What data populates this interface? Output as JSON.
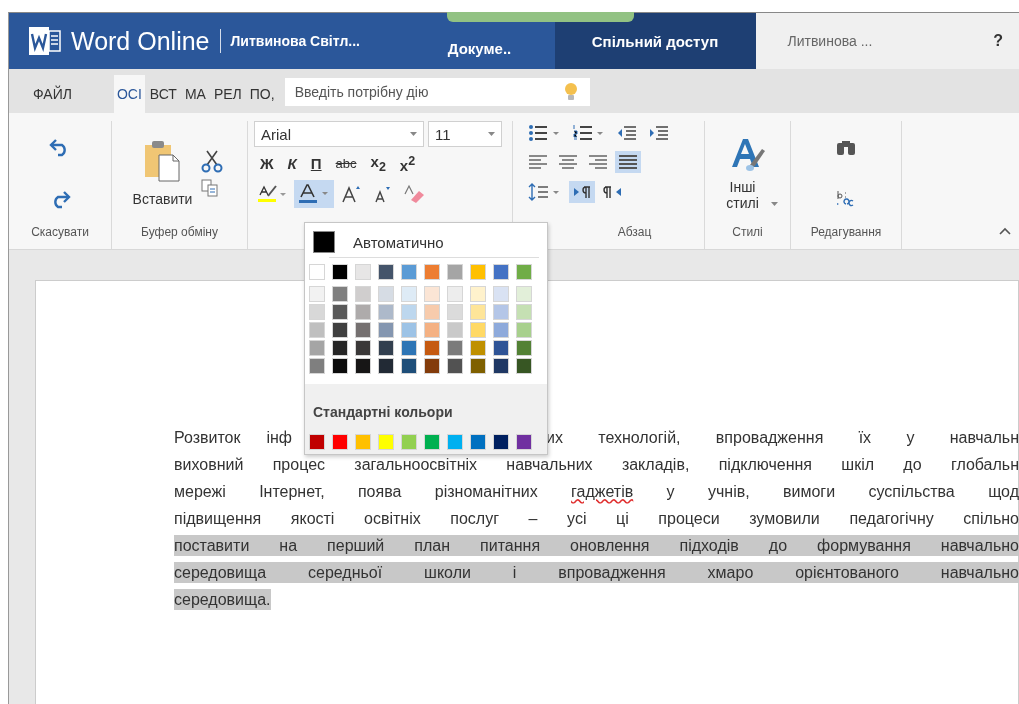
{
  "title_bar": {
    "app_name": "Word Online",
    "user": "Литвинова Світл...",
    "tabs": [
      {
        "label": "Докуме..",
        "selected": false
      },
      {
        "label": "Спільний доступ",
        "selected": true
      }
    ],
    "account": "Литвинова ...",
    "help": "?"
  },
  "ribbon_tabs": [
    {
      "label": "ФАЙЛ",
      "selected": false
    },
    {
      "label": "ОСІ",
      "selected": true
    },
    {
      "label": "ВСТ",
      "selected": false
    },
    {
      "label": "МА",
      "selected": false
    },
    {
      "label": "РЕЛ",
      "selected": false
    },
    {
      "label": "ПО,",
      "selected": false
    }
  ],
  "tell_me": {
    "placeholder": "Введіть потрібну дію"
  },
  "ribbon": {
    "undo_group": {
      "label": "Скасувати"
    },
    "clipboard_group": {
      "label": "Буфер обміну",
      "paste": "Вставити"
    },
    "font_group": {
      "font": "Arial",
      "size": "11",
      "format_buttons": [
        {
          "kind": "bold",
          "label": "Ж"
        },
        {
          "kind": "italic",
          "label": "К"
        },
        {
          "kind": "underline",
          "label": "П"
        },
        {
          "kind": "strike",
          "label": "abc"
        },
        {
          "kind": "subscript",
          "label": "x$_{2}$"
        },
        {
          "kind": "superscript",
          "label": "x$^{2}$"
        }
      ],
      "font_color_open": true
    },
    "paragraph_group": {
      "label": "Абзац",
      "alignment": [
        {
          "kind": "left",
          "selected": false
        },
        {
          "kind": "center",
          "selected": false
        },
        {
          "kind": "right",
          "selected": false
        },
        {
          "kind": "justify",
          "selected": true
        }
      ],
      "direction": [
        {
          "kind": "ltr",
          "selected": true
        },
        {
          "kind": "rtl",
          "selected": false
        }
      ]
    },
    "styles_group": {
      "label": "Стилі",
      "button": "Інші стилі"
    },
    "editing_group": {
      "label": "Редагування"
    }
  },
  "color_menu": {
    "automatic": "Автоматично",
    "theme_rows": [
      {
        "swatches": [
          {
            "color": "#ffffff"
          },
          {
            "color": "#000000"
          },
          {
            "color": "#e7e6e6"
          },
          {
            "color": "#44546a"
          },
          {
            "color": "#5b9bd5"
          },
          {
            "color": "#ed7d31"
          },
          {
            "color": "#a5a5a5"
          },
          {
            "color": "#ffc000"
          },
          {
            "color": "#4472c4"
          },
          {
            "color": "#70ad47"
          }
        ]
      },
      {
        "swatches": [
          {
            "color": "#f2f2f2"
          },
          {
            "color": "#7f7f7f"
          },
          {
            "color": "#d0cece"
          },
          {
            "color": "#d6dce4"
          },
          {
            "color": "#deebf6"
          },
          {
            "color": "#fbe5d5"
          },
          {
            "color": "#ededed"
          },
          {
            "color": "#fff2cc"
          },
          {
            "color": "#d9e2f3"
          },
          {
            "color": "#e2efd9"
          }
        ]
      },
      {
        "swatches": [
          {
            "color": "#d8d8d8"
          },
          {
            "color": "#595959"
          },
          {
            "color": "#aeabab"
          },
          {
            "color": "#adb9ca"
          },
          {
            "color": "#bdd7ee"
          },
          {
            "color": "#f7cbac"
          },
          {
            "color": "#dbdbdb"
          },
          {
            "color": "#fee599"
          },
          {
            "color": "#b4c6e7"
          },
          {
            "color": "#c5e0b3"
          }
        ]
      },
      {
        "swatches": [
          {
            "color": "#bfbfbf"
          },
          {
            "color": "#3f3f3f"
          },
          {
            "color": "#757070"
          },
          {
            "color": "#8496b0"
          },
          {
            "color": "#9dc3e6"
          },
          {
            "color": "#f4b183"
          },
          {
            "color": "#c9c9c9"
          },
          {
            "color": "#ffd965"
          },
          {
            "color": "#8eaadb"
          },
          {
            "color": "#a8d08d"
          }
        ]
      },
      {
        "swatches": [
          {
            "color": "#a5a5a5"
          },
          {
            "color": "#262626"
          },
          {
            "color": "#3a3838"
          },
          {
            "color": "#323f4f"
          },
          {
            "color": "#2e75b5"
          },
          {
            "color": "#c55a11"
          },
          {
            "color": "#7b7b7b"
          },
          {
            "color": "#bf9000"
          },
          {
            "color": "#2f5496"
          },
          {
            "color": "#538135"
          }
        ]
      },
      {
        "swatches": [
          {
            "color": "#7f7f7f"
          },
          {
            "color": "#0c0c0c"
          },
          {
            "color": "#171616"
          },
          {
            "color": "#222a35"
          },
          {
            "color": "#1e4e79"
          },
          {
            "color": "#833c0b"
          },
          {
            "color": "#525252"
          },
          {
            "color": "#7f6000"
          },
          {
            "color": "#1f3864"
          },
          {
            "color": "#375623"
          }
        ]
      }
    ],
    "standard_label": "Стандартні кольори",
    "standard_colors": [
      {
        "color": "#c00000"
      },
      {
        "color": "#ff0000"
      },
      {
        "color": "#ffc000"
      },
      {
        "color": "#ffff00"
      },
      {
        "color": "#92d050"
      },
      {
        "color": "#00b050"
      },
      {
        "color": "#00b0f0"
      },
      {
        "color": "#0070c0"
      },
      {
        "color": "#002060"
      },
      {
        "color": "#7030a0"
      }
    ]
  },
  "document": {
    "lines": [
      {
        "highlighted": false,
        "parts": [
          {
            "text": "Розвиток інф"
          },
          {
            "text": "их технологій, впровадження їх у навчальн"
          }
        ]
      },
      {
        "highlighted": false,
        "parts": [
          {
            "text": "виховний процес загальноосвітніх навчальних закладів, підключення шкіл до глобальн"
          }
        ]
      },
      {
        "highlighted": false,
        "parts": [
          {
            "segments": [
              {
                "text": "мережі Інтернет, поява різноманітних ",
                "misspelled": false
              },
              {
                "text": "гаджетів",
                "misspelled": true
              },
              {
                "text": " у учнів, вимоги суспільства щод",
                "misspelled": false
              }
            ]
          }
        ]
      },
      {
        "highlighted": false,
        "parts": [
          {
            "text": "підвищення якості освітніх послуг – усі ці процеси зумовили педагогічну спільно"
          }
        ]
      },
      {
        "highlighted": true,
        "parts": [
          {
            "text": "поставити на перший план питання оновлення підходів до формування навчально"
          }
        ]
      },
      {
        "highlighted": true,
        "parts": [
          {
            "text": "середовища середньої школи і впровадження хмаро орієнтованого навчально"
          }
        ]
      },
      {
        "highlighted": true,
        "parts": [
          {
            "text": "середовища."
          }
        ]
      }
    ]
  }
}
